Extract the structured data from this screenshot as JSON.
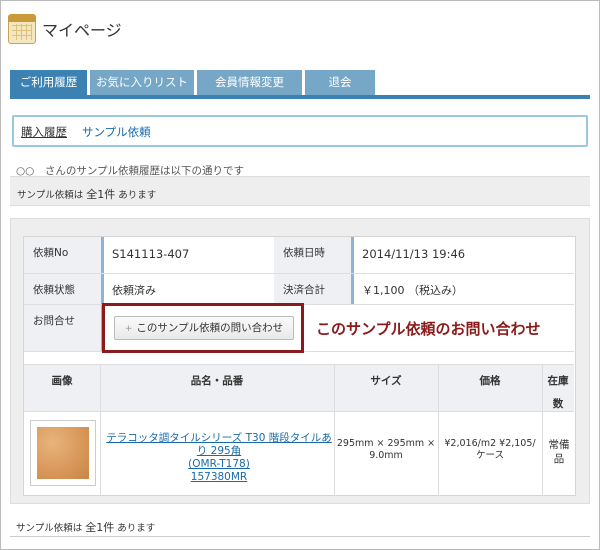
{
  "header": {
    "title": "マイページ"
  },
  "tabs": [
    {
      "label": "ご利用履歴",
      "active": true
    },
    {
      "label": "お気に入りリスト",
      "active": false
    },
    {
      "label": "会員情報変更",
      "active": false
    },
    {
      "label": "退会",
      "active": false
    }
  ],
  "subnav": {
    "purchase_history": "購入履歴",
    "sample_request": "サンプル依頼"
  },
  "intro": "○○　さんのサンプル依頼履歴は以下の通りです",
  "count": {
    "prefix": "サンプル依頼は",
    "value": "全1件",
    "suffix": "あります"
  },
  "order": {
    "request_no_label": "依頼No",
    "request_no": "S141113-407",
    "request_date_label": "依頼日時",
    "request_date": "2014/11/13 19:46",
    "status_label": "依頼状態",
    "status": "依頼済み",
    "total_label": "決済合計",
    "total": "￥1,100 （税込み）",
    "inquiry_label": "お問合せ",
    "inquiry_button": "このサンプル依頼の問い合わせ"
  },
  "callout": "このサンプル依頼のお問い合わせ",
  "product_table": {
    "headers": {
      "image": "画像",
      "name": "品名・品番",
      "size": "サイズ",
      "price": "価格",
      "stock_1": "在庫",
      "stock_2": "数"
    },
    "row": {
      "name_line1": "テラコッタ調タイルシリーズ T30 階段タイルあり 295角",
      "name_line2": "(OMR-T178)",
      "code": "157380MR",
      "size_line1": "295mm × 295mm ×",
      "size_line2": "9.0mm",
      "price_line1": "¥2,016/m2 ¥2,105/",
      "price_line2": "ケース",
      "stock_line1": "常備",
      "stock_line2": "品"
    }
  },
  "colors": {
    "tab_active": "#3b82b3",
    "tab": "#76a7c6",
    "callout": "#8b1a1a",
    "link": "#1a6aa8"
  }
}
